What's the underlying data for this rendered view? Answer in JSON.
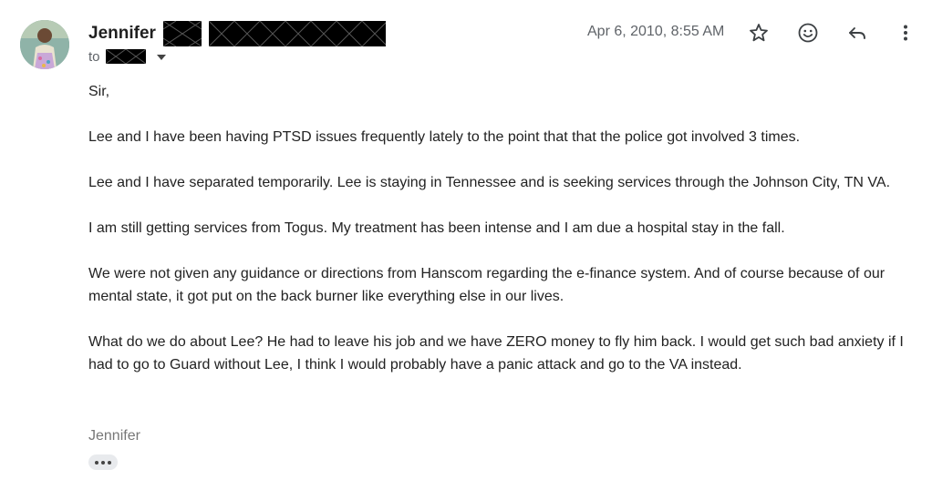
{
  "sender": {
    "name": "Jennifer",
    "to_label": "to"
  },
  "date": "Apr 6, 2010, 8:55 AM",
  "actions": {
    "star_icon": "star-icon",
    "emoji_icon": "emoji-icon",
    "reply_icon": "reply-icon",
    "more_icon": "more-vert-icon"
  },
  "body": {
    "greeting": "Sir,",
    "paragraphs": [
      "Lee and I have been having PTSD issues frequently lately to the point that that the police got involved 3 times.",
      "Lee and I have separated temporarily.  Lee is staying in Tennessee and is seeking services through the Johnson City, TN VA.",
      "I am still getting services from Togus.  My treatment has been intense and I am due a hospital stay in the fall.",
      "We were not given any guidance or directions from Hanscom regarding the e-finance system.  And of course because of our mental state, it got put on the back burner like everything else in our lives.",
      "What do we do about Lee?  He had to leave his job and we have ZERO money to fly him back.  I would get such bad anxiety if I had to go to Guard without Lee, I think I would probably have a panic attack and go to the VA instead."
    ]
  },
  "signature": "Jennifer",
  "colors": {
    "text": "#222222",
    "muted": "#5f6368",
    "signature": "#777777",
    "redaction": "#000000"
  }
}
